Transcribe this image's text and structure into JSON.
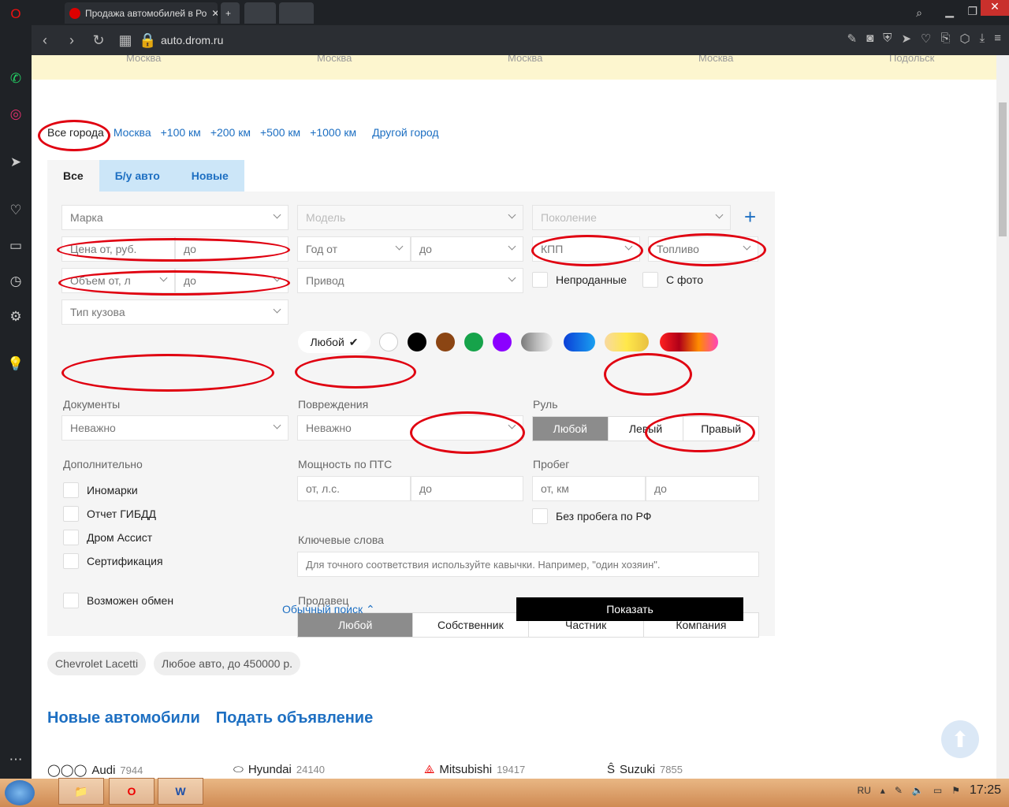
{
  "browser": {
    "tab_title": "Продажа автомобилей в Ро",
    "url": "auto.drom.ru"
  },
  "top_strip": [
    "Москва",
    "Москва",
    "Москва",
    "Москва",
    "Подольск"
  ],
  "geo": {
    "current": "Все города",
    "options": [
      "Москва",
      "+100 км",
      "+200 км",
      "+500 км",
      "+1000 км"
    ],
    "other": "Другой город"
  },
  "tabs": [
    "Все",
    "Б/у авто",
    "Новые"
  ],
  "filters": {
    "brand": "Марка",
    "model": "Модель",
    "generation": "Поколение",
    "price_from": "Цена от, руб.",
    "price_to": "до",
    "year_from": "Год от",
    "year_to": "до",
    "transmission": "КПП",
    "fuel": "Топливо",
    "volume_from": "Объем от, л",
    "volume_to": "до",
    "drive": "Привод",
    "unsold": "Непроданные",
    "with_photo": "С фото",
    "body": "Тип кузова",
    "color_any": "Любой",
    "documents_label": "Документы",
    "documents_value": "Неважно",
    "damage_label": "Повреждения",
    "damage_value": "Неважно",
    "wheel_label": "Руль",
    "wheel_options": [
      "Любой",
      "Левый",
      "Правый"
    ],
    "extra_label": "Дополнительно",
    "extra_options": [
      "Иномарки",
      "Отчет ГИБДД",
      "Дром Ассист",
      "Сертификация"
    ],
    "exchange": "Возможен обмен",
    "power_label": "Мощность по ПТС",
    "power_from": "от, л.с.",
    "power_to": "до",
    "mileage_label": "Пробег",
    "mileage_from": "от, км",
    "mileage_to": "до",
    "no_rf_mileage": "Без пробега по РФ",
    "keywords_label": "Ключевые слова",
    "keywords_placeholder": "Для точного соответствия используйте кавычки. Например, \"один хозяин\".",
    "seller_label": "Продавец",
    "seller_options": [
      "Любой",
      "Собственник",
      "Частник",
      "Компания"
    ],
    "plain_search": "Обычный поиск",
    "show": "Показать"
  },
  "colors": [
    "#ffffff",
    "#000000",
    "#8b4513",
    "#16a34a",
    "#8b00ff",
    "#9a9a9a",
    "#0b5ed7",
    "#f5d76e",
    "#e21b1b"
  ],
  "saved": [
    "Chevrolet Lacetti",
    "Любое авто, до 450000 р."
  ],
  "links": [
    "Новые автомобили",
    "Подать объявление"
  ],
  "brands": [
    {
      "name": "Audi",
      "count": "7944"
    },
    {
      "name": "Hyundai",
      "count": "24140"
    },
    {
      "name": "Mitsubishi",
      "count": "19417"
    },
    {
      "name": "Suzuki",
      "count": "7855"
    }
  ],
  "taskbar": {
    "lang": "RU",
    "time": "17:25"
  }
}
